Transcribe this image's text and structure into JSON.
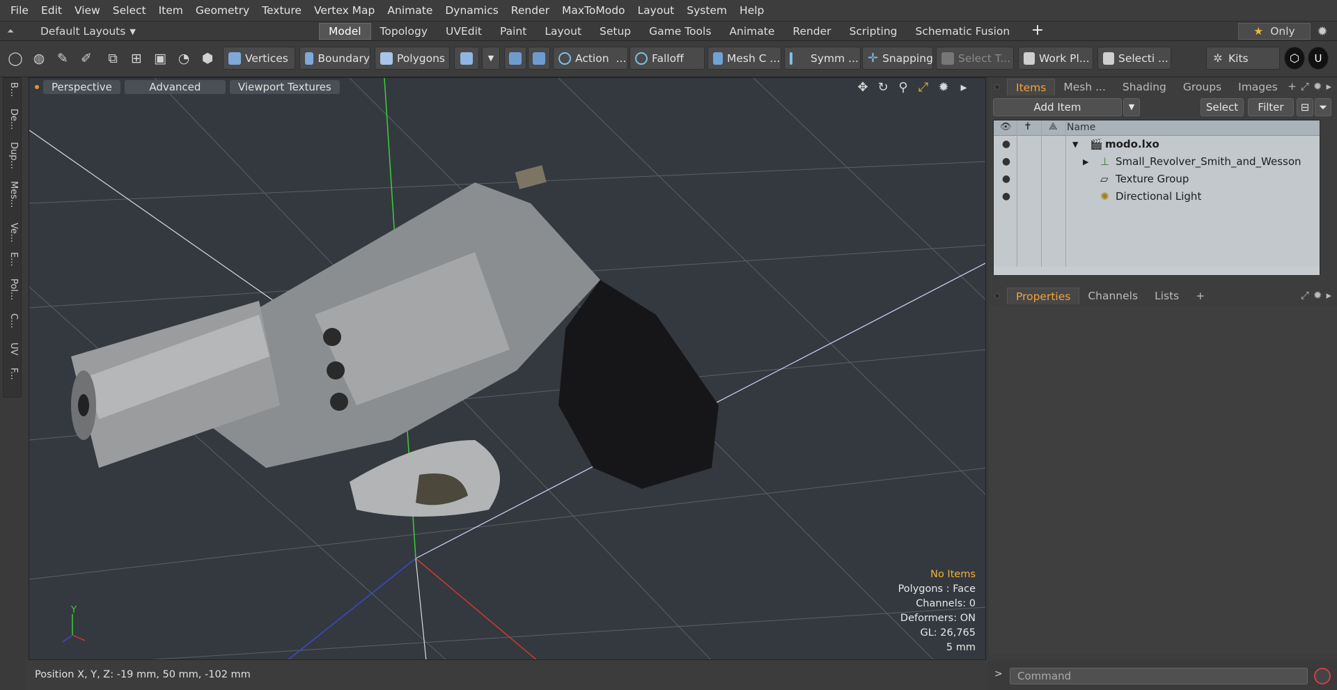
{
  "menubar": {
    "items": [
      "File",
      "Edit",
      "View",
      "Select",
      "Item",
      "Geometry",
      "Texture",
      "Vertex Map",
      "Animate",
      "Dynamics",
      "Render",
      "MaxToModo",
      "Layout",
      "System",
      "Help"
    ]
  },
  "layoutbar": {
    "layout_name": "Default Layouts",
    "tabs": [
      "Model",
      "Topology",
      "UVEdit",
      "Paint",
      "Layout",
      "Setup",
      "Game Tools",
      "Animate",
      "Render",
      "Scripting",
      "Schematic Fusion"
    ],
    "active_tab": "Model",
    "only_label": "Only"
  },
  "toolbar": {
    "vertices": "Vertices",
    "boundary": "Boundary",
    "polygons": "Polygons",
    "action": "Action",
    "action_more": "...",
    "falloff": "Falloff",
    "mesh": "Mesh C ...",
    "symm": "Symm ...",
    "snapping": "Snapping",
    "select_t": "Select T...",
    "workplane": "Work Pl...",
    "selection": "Selecti ...",
    "kits": "Kits"
  },
  "lefttabs": [
    "B...",
    "De...",
    "Dup...",
    "Mes...",
    "Ve...",
    "E...",
    "Pol...",
    "C...",
    "UV",
    "F..."
  ],
  "viewport": {
    "perspective": "Perspective",
    "advanced": "Advanced",
    "textures": "Viewport Textures",
    "stats": {
      "no_items": "No Items",
      "polygons": "Polygons : Face",
      "channels": "Channels: 0",
      "deformers": "Deformers: ON",
      "gl": "GL: 26,765",
      "units": "5 mm"
    },
    "axis_y": "Y"
  },
  "status": {
    "position": "Position X, Y, Z:   -19 mm, 50 mm, -102 mm"
  },
  "items_panel": {
    "tabs": [
      "Items",
      "Mesh ...",
      "Shading",
      "Groups",
      "Images"
    ],
    "active": "Items",
    "add_item": "Add Item",
    "select": "Select",
    "filter": "Filter",
    "name_header": "Name",
    "rows": [
      "modo.lxo",
      "Small_Revolver_Smith_and_Wesson",
      "Texture Group",
      "Directional Light"
    ]
  },
  "props_panel": {
    "tabs": [
      "Properties",
      "Channels",
      "Lists"
    ],
    "active": "Properties"
  },
  "command": {
    "placeholder": "Command"
  },
  "colors": {
    "accent": "#f2a33a",
    "viewport_bg": "#34393f"
  }
}
